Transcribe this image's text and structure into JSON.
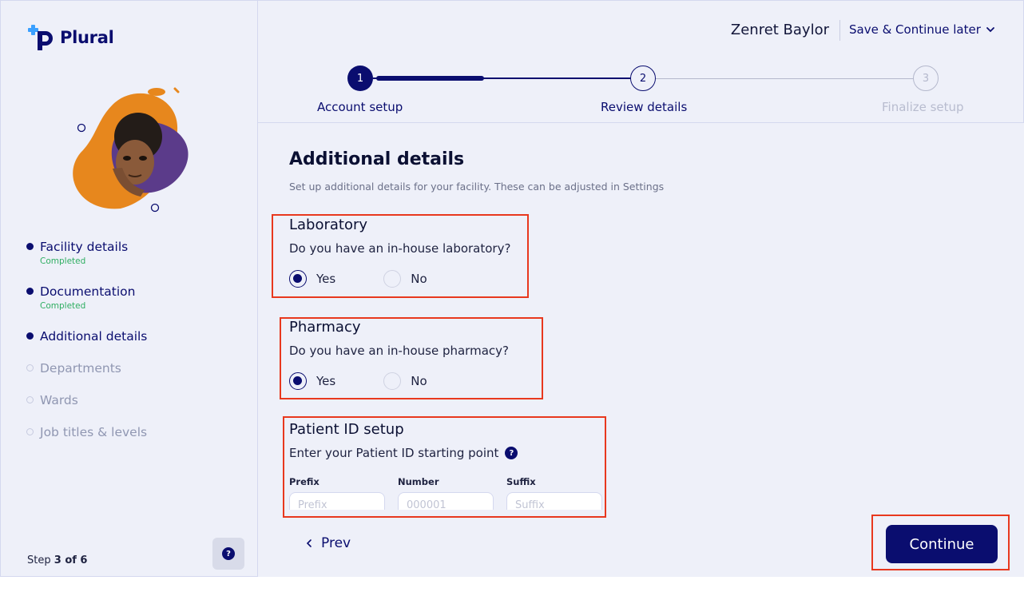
{
  "brand": {
    "name": "Plural",
    "logo_icon": "plus-p-logo-icon"
  },
  "header": {
    "user_name": "Zenret Baylor",
    "save_later_label": "Save & Continue later"
  },
  "progress": {
    "steps": [
      {
        "number": "1",
        "label": "Account setup",
        "state": "active"
      },
      {
        "number": "2",
        "label": "Review details",
        "state": "next"
      },
      {
        "number": "3",
        "label": "Finalize setup",
        "state": "future"
      }
    ],
    "fill_fraction": 0.38
  },
  "sidebar": {
    "steps": [
      {
        "label": "Facility details",
        "sub": "Completed",
        "state": "done"
      },
      {
        "label": "Documentation",
        "sub": "Completed",
        "state": "done"
      },
      {
        "label": "Additional details",
        "sub": "",
        "state": "current"
      },
      {
        "label": "Departments",
        "sub": "",
        "state": "pending"
      },
      {
        "label": "Wards",
        "sub": "",
        "state": "pending"
      },
      {
        "label": "Job titles & levels",
        "sub": "",
        "state": "pending"
      }
    ],
    "step_count_prefix": "Step",
    "step_count_value": "3 of 6",
    "help_icon": "question-icon"
  },
  "main": {
    "title": "Additional details",
    "subtitle": "Set up additional details for your facility. These can be adjusted in Settings",
    "laboratory": {
      "title": "Laboratory",
      "question": "Do you have an in-house laboratory?",
      "yes_label": "Yes",
      "no_label": "No",
      "selected": "Yes"
    },
    "pharmacy": {
      "title": "Pharmacy",
      "question": "Do you have an in-house pharmacy?",
      "yes_label": "Yes",
      "no_label": "No",
      "selected": "Yes"
    },
    "patient_id": {
      "title": "Patient ID setup",
      "question": "Enter your Patient ID starting point",
      "prefix_label": "Prefix",
      "prefix_placeholder": "Prefix",
      "number_label": "Number",
      "number_placeholder": "000001",
      "suffix_label": "Suffix",
      "suffix_placeholder": "Suffix"
    }
  },
  "footer": {
    "prev_label": "Prev",
    "continue_label": "Continue"
  },
  "colors": {
    "brand_navy": "#0a0d6f",
    "background": "#eef0f9",
    "completed_green": "#2fae62",
    "highlight_red": "#e8381e"
  }
}
